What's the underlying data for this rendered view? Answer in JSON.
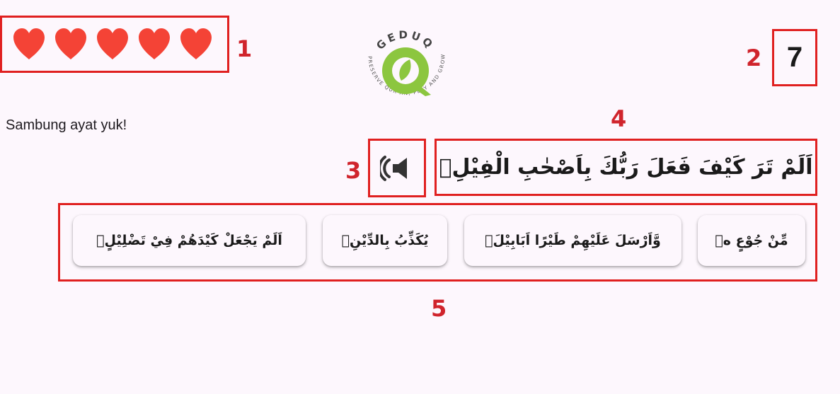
{
  "lives": {
    "count": 5,
    "icon": "heart-icon",
    "color": "#f44336"
  },
  "score": {
    "value": "7"
  },
  "logo": {
    "brand": "GEDUQ",
    "tagline": "PRESERVE QUR'AN, PLAY AND GROW",
    "color": "#8cc63f"
  },
  "prompt": "Sambung ayat yuk!",
  "audio_button": {
    "icon": "speaker-icon"
  },
  "ayah": "اَلَمْ تَرَ كَيْفَ فَعَلَ رَبُّكَ بِاَصْحٰبِ الْفِيْلِۗ",
  "options": [
    "اَلَمْ يَجْعَلْ كَيْدَهُمْ فِيْ تَضْلِيْلٍۙ",
    "يُكَذِّبُ بِالدِّيْنِۗ",
    "وَّاَرْسَلَ عَلَيْهِمْ طَيْرًا اَبَابِيْلَۙ",
    "مِّنْ جُوْعٍ ەۙ"
  ],
  "annotations": [
    "1",
    "2",
    "3",
    "4",
    "5"
  ],
  "colors": {
    "annotation": "#e02020",
    "background": "#fdf7fd"
  }
}
